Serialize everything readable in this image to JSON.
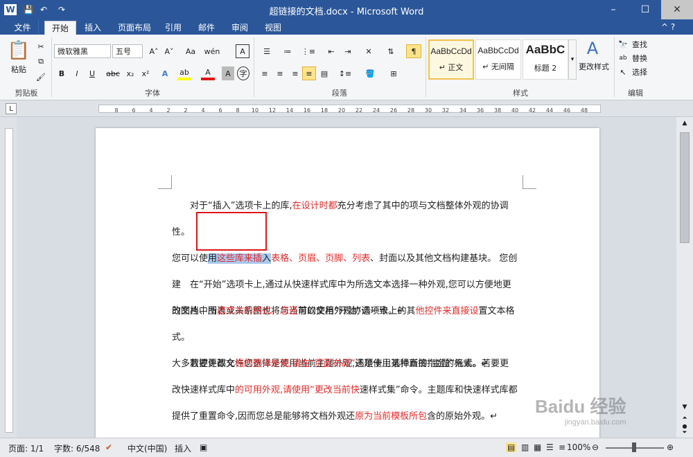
{
  "window": {
    "title": "超链接的文档.docx - Microsoft Word"
  },
  "quick_access": {
    "logo": "W",
    "save": "💾",
    "undo": "↶",
    "redo": "↷"
  },
  "window_controls": {
    "minimize": "–",
    "maximize": "☐",
    "close": "✕"
  },
  "tabs": [
    "文件",
    "开始",
    "插入",
    "页面布局",
    "引用",
    "邮件",
    "审阅",
    "视图"
  ],
  "ribbon": {
    "clipboard": {
      "label": "剪贴板",
      "paste": "粘贴"
    },
    "font": {
      "label": "字体",
      "name": "微软雅黑",
      "size": "五号",
      "bold": "B",
      "italic": "I",
      "underline": "U",
      "strike": "abc",
      "sub": "x₂",
      "sup": "x²",
      "grow": "A˄",
      "shrink": "A˅",
      "case": "Aa"
    },
    "paragraph": {
      "label": "段落"
    },
    "styles": {
      "label": "样式",
      "items": [
        {
          "preview": "AaBbCcDd",
          "name": "↵ 正文"
        },
        {
          "preview": "AaBbCcDd",
          "name": "↵ 无间隔"
        },
        {
          "preview": "AaBbC",
          "name": "标题 2"
        }
      ],
      "change": "更改样式"
    },
    "editing": {
      "label": "编辑",
      "find": "查找",
      "replace": "替换",
      "select": "选择"
    }
  },
  "ruler_numbers": [
    "8",
    "6",
    "4",
    "2",
    "2",
    "4",
    "6",
    "8",
    "10",
    "12",
    "14",
    "16",
    "18",
    "20",
    "22",
    "24",
    "26",
    "28",
    "30",
    "32",
    "34",
    "36",
    "38",
    "40",
    "42",
    "44",
    "46",
    "48"
  ],
  "document": {
    "p1_line1_a": "对于“插入”选项卡上的库,",
    "p1_line1_red": "在设计时都",
    "p1_line1_b": "充分考虑了其中的项与文档整体外观的协调性。",
    "p1_line2_a": "您可以使",
    "p1_line2_hl_a": "用",
    "p1_line2_hl_red": "这些库来插",
    "p1_line2_hl_b": "入",
    "p1_line2_red": "表格、页眉、页脚、列表",
    "p1_line2_b": "、封面以及其他文档构建基块。 您创建",
    "p1_line3": "的图片、图表或关系图也将与当前的文档外观协调一致。↵",
    "p2_line1": "在“开始”选项卡上,通过从快速样式库中为所选文本选择一种外观,您可以方便地更",
    "p2_line2_a": "改文档中所",
    "p2_line2_red1": "选文本的格式。您还",
    "p2_line2_b": "可以使用“开始”选项卡上的其",
    "p2_line2_red2": "他控件来直接设",
    "p2_line2_c": "置文本格式。",
    "p2_line3": "大多数控件都允许您选择是使用当前主题外观,还是使用某种直接指定的格式。↵",
    "p3_line1_a": "若要更改文",
    "p3_line1_red": "档的整体外观,请在“页面布局”",
    "p3_line1_b": "选项卡上选择新的“主题”元素。若要更",
    "p3_line2_a": "改快速样式库中",
    "p3_line2_red": "的可用外观,请使用“更改当前快",
    "p3_line2_b": "速样式集”命令。主题库和快速样式库都",
    "p3_line3_a": "提供了重置命令,因而您总是能够将文档外观还",
    "p3_line3_red": "原为当前模板所包",
    "p3_line3_b": "含的原始外观。↵"
  },
  "status": {
    "page": "页面: 1/1",
    "words": "字数: 6/548",
    "lang": "中文(中国)",
    "mode": "插入",
    "zoom": "100%"
  },
  "watermark": {
    "text": "Baidu 经验",
    "url": "jingyan.baidu.com"
  },
  "colors": {
    "accent": "#2b579a",
    "red_text": "#e52b2b",
    "highlight": "#a9c9ee",
    "redbox": "#e01515"
  }
}
